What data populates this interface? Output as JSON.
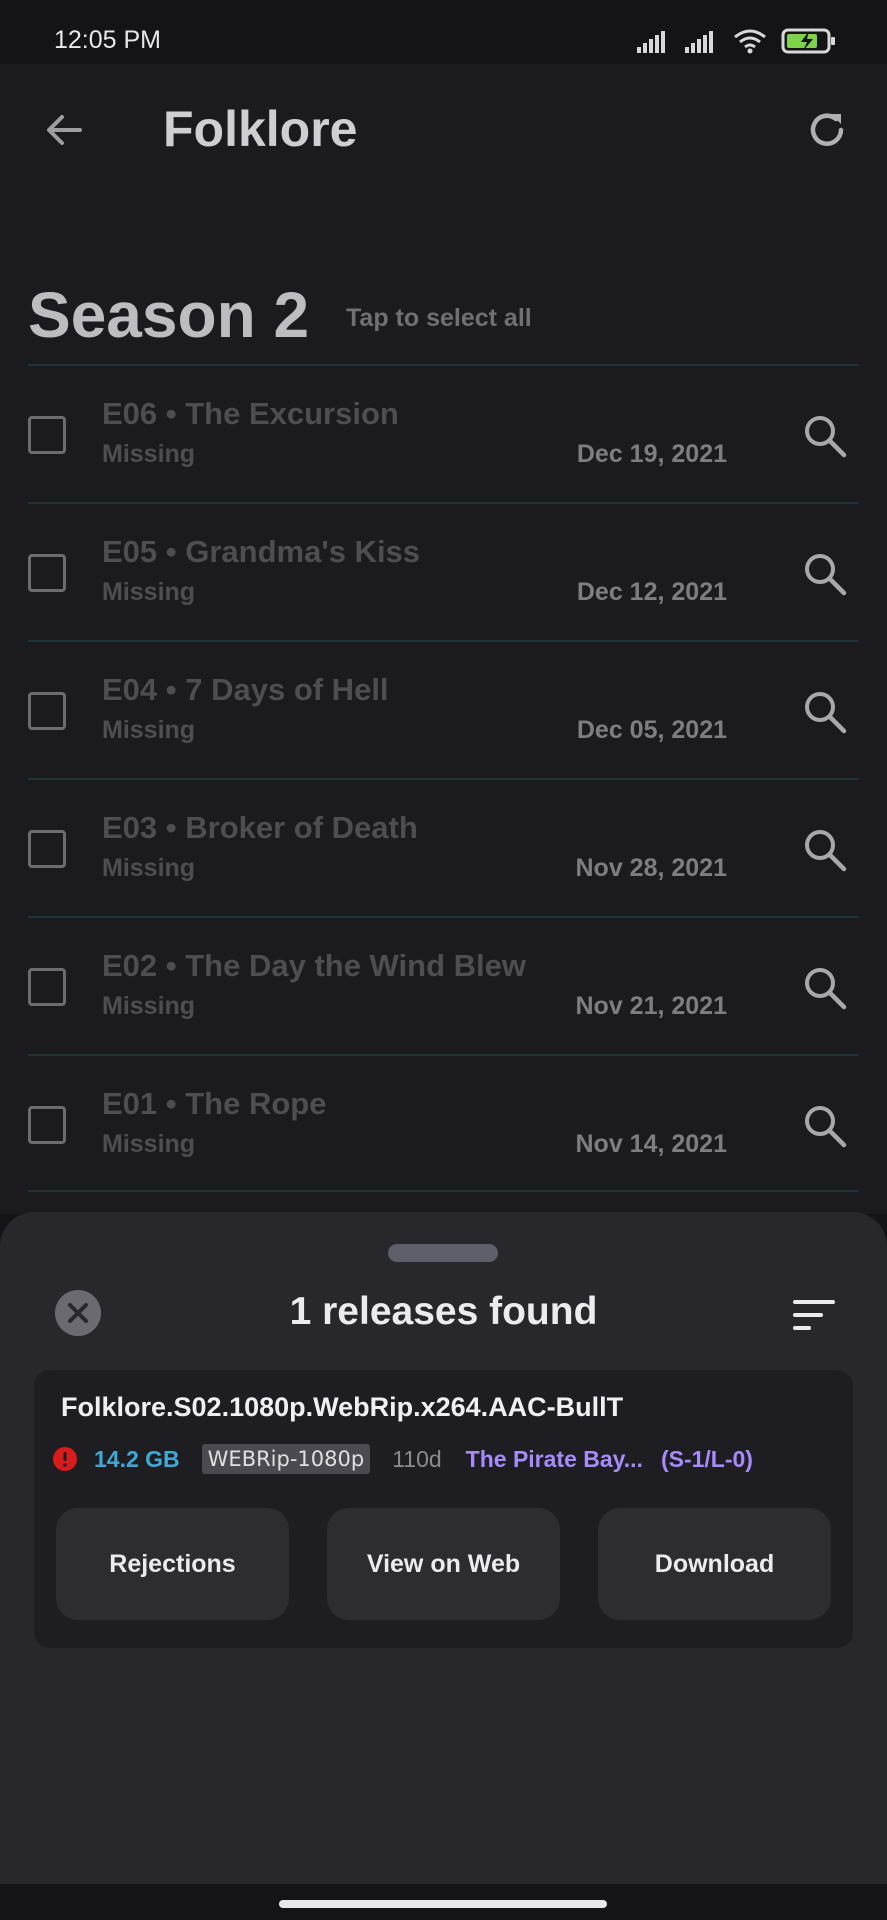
{
  "status_bar": {
    "time": "12:05 PM"
  },
  "app_bar": {
    "title": "Folklore",
    "back_icon": "arrow-left-icon",
    "refresh_icon": "refresh-icon"
  },
  "season": {
    "title": "Season 2",
    "select_all": "Tap to select all"
  },
  "episodes": [
    {
      "title": "E06 • The Excursion",
      "status": "Missing",
      "date": "Dec 19, 2021"
    },
    {
      "title": "E05 • Grandma's Kiss",
      "status": "Missing",
      "date": "Dec 12, 2021"
    },
    {
      "title": "E04 • 7 Days of Hell",
      "status": "Missing",
      "date": "Dec 05, 2021"
    },
    {
      "title": "E03 • Broker of Death",
      "status": "Missing",
      "date": "Nov 28, 2021"
    },
    {
      "title": "E02 • The Day the Wind Blew",
      "status": "Missing",
      "date": "Nov 21, 2021"
    },
    {
      "title": "E01 • The Rope",
      "status": "Missing",
      "date": "Nov 14, 2021"
    }
  ],
  "sheet": {
    "title": "1 releases found",
    "close_icon": "close-circle-icon",
    "sort_icon": "sort-icon",
    "release": {
      "name": "Folklore.S02.1080p.WebRip.x264.AAC-BullT",
      "size": "14.2 GB",
      "quality": "WEBRip-1080p",
      "age": "110d",
      "indexer": "The Pirate Bay...",
      "peers": "(S-1/L-0)",
      "warning_color": "#d81b1b"
    },
    "actions": {
      "rejections": "Rejections",
      "view_on_web": "View on Web",
      "download": "Download"
    }
  },
  "colors": {
    "background": "#141417",
    "surface": "#1b1b1f",
    "sheet": "#27272c",
    "accent_blue": "#3fa9d6",
    "accent_purple": "#a78bfa"
  }
}
